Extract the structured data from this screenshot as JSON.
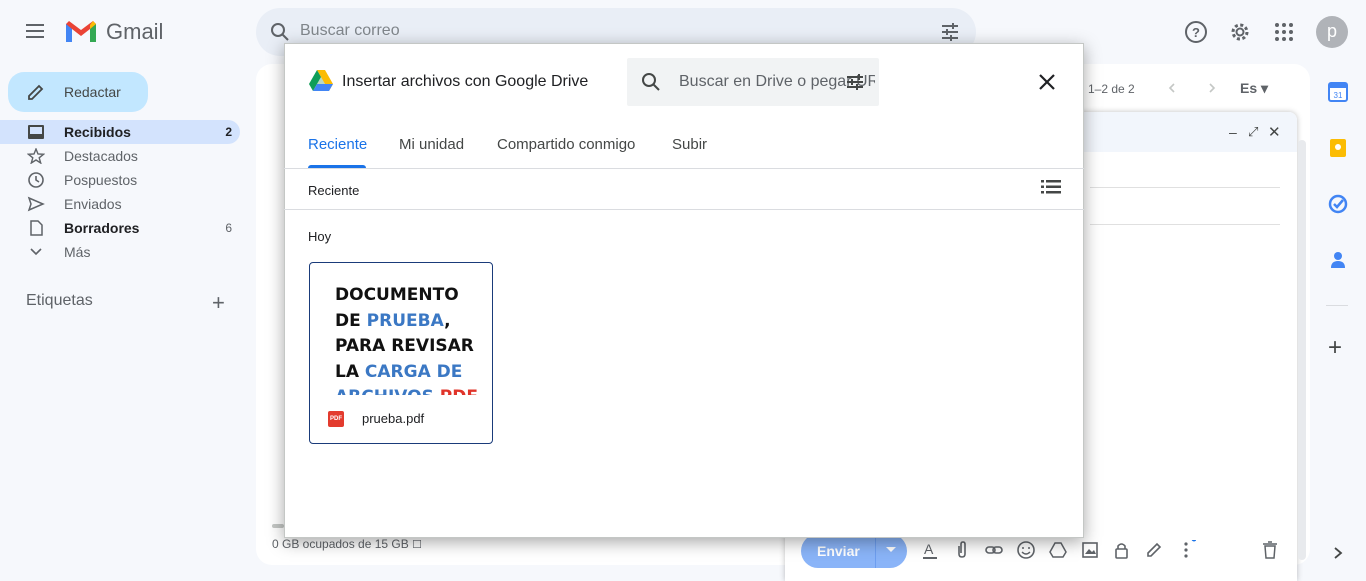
{
  "gmail": {
    "brand": "Gmail",
    "search_placeholder": "Buscar correo",
    "avatar_letter": "p",
    "compose_label": "Redactar",
    "nav": [
      {
        "label": "Recibidos",
        "count": "2",
        "icon": "inbox-icon"
      },
      {
        "label": "Destacados",
        "count": "",
        "icon": "star-icon"
      },
      {
        "label": "Pospuestos",
        "count": "",
        "icon": "clock-icon"
      },
      {
        "label": "Enviados",
        "count": "",
        "icon": "send-icon"
      },
      {
        "label": "Borradores",
        "count": "6",
        "icon": "draft-icon"
      },
      {
        "label": "Más",
        "count": "",
        "icon": "chevron-down-icon"
      }
    ],
    "labels_heading": "Etiquetas",
    "pager": "1–2 de 2",
    "lang": "Es",
    "storage": "0 GB ocupados de 15 GB",
    "send_label": "Enviar"
  },
  "modal": {
    "title": "Insertar archivos con Google Drive",
    "search_placeholder": "Buscar en Drive o pegar URL",
    "tabs": [
      "Reciente",
      "Mi unidad",
      "Compartido conmigo",
      "Subir"
    ],
    "breadcrumb": "Reciente",
    "section": "Hoy",
    "file": {
      "name": "prueba.pdf",
      "badge": "PDF",
      "preview_lines": [
        [
          "DOCUMENTO",
          ""
        ],
        [
          "DE ",
          "PRUEBA",
          ","
        ],
        [
          "PARA REVISAR",
          ""
        ],
        [
          "LA ",
          "CARGA DE"
        ],
        [
          "ARCHIVOS ",
          "PDF"
        ]
      ]
    }
  },
  "colors": {
    "accent": "#1a73e8",
    "compose_bg": "#c2e7ff",
    "active_nav": "#d3e3fd"
  }
}
